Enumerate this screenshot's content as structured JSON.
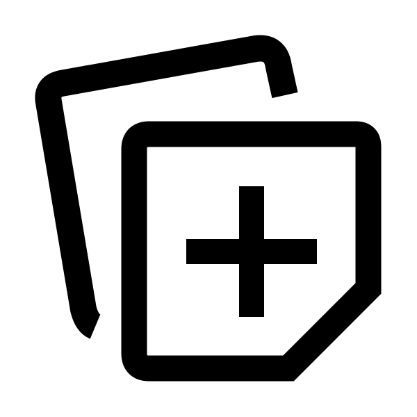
{
  "icon": {
    "name": "add-note-icon",
    "parts": [
      "back-note",
      "front-note",
      "plus-sign"
    ],
    "colors": {
      "stroke": "#000000",
      "background": "#ffffff",
      "fill": "#ffffff"
    }
  }
}
